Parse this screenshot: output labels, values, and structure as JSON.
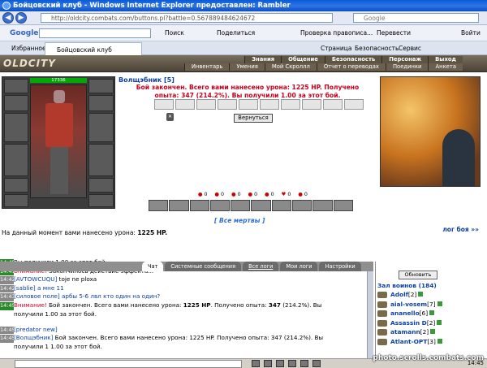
{
  "window": {
    "title": "Бойцовский клуб - Windows Internet Explorer предоставлен: Rambler"
  },
  "address": {
    "url": "http://oldcity.combats.com/buttons.pl?battle=0.567889484624672",
    "search_placeholder": "Google"
  },
  "google_toolbar": {
    "label": "Google",
    "items": [
      "Поиск",
      "Поделиться",
      "Проверка правописа...",
      "Перевести",
      "Войти"
    ]
  },
  "tabs": {
    "favorites": "Избранное",
    "active_tab": "Бойцовский клуб",
    "tools": [
      "Страница",
      "Безопасность",
      "Сервис"
    ]
  },
  "game": {
    "logo": "OLDCITY",
    "menu_top": [
      "Знания",
      "Общение",
      "Безопасность",
      "Персонаж",
      "Выход"
    ],
    "menu_bottom": [
      "Инвентарь",
      "Умения",
      "Мой Скроллл",
      "Отчет о переводах",
      "Поединки",
      "Анкета"
    ]
  },
  "battle": {
    "hp": "17336",
    "opponent_name": "Волщэбник",
    "opponent_level": "[5]",
    "message": "Бой закончен. Всего вами нанесено урона: 1225 HP. Получено опыта: 347 (214.2%). Вы получили",
    "message_amount": "1.00 за этот бой.",
    "back_button": "Вернуться",
    "stats": [
      "0",
      "0",
      "0",
      "0",
      "0",
      "0",
      "0"
    ],
    "all_dead_link": "[ Все мертвы ]",
    "damage_text": "На данный момент вами нанесено урона:",
    "damage_value": "1225 HP.",
    "battle_log_link": "лог боя »»"
  },
  "chat": {
    "tabs": [
      "Чат",
      "Системные сообщения",
      "Все логи",
      "Мои логи",
      "Настройки"
    ],
    "lines": [
      {
        "time": "14:45",
        "style": "g",
        "parts": [
          {
            "c": "",
            "t": "Вы получили 1.00 за этот бой."
          }
        ]
      },
      {
        "time": "14:41",
        "style": "g",
        "parts": [
          {
            "c": "red",
            "t": "Внимание!"
          },
          {
            "c": "",
            "t": " Закончилось действие эффекта..."
          }
        ]
      },
      {
        "time": "14:42",
        "style": "gr",
        "parts": [
          {
            "c": "blue",
            "t": "[AVTOWCUQU]"
          },
          {
            "c": "",
            "t": " toje ne ploxa"
          }
        ]
      },
      {
        "time": "14:42",
        "style": "gr",
        "parts": [
          {
            "c": "blue",
            "t": "[sablie]"
          },
          {
            "c": "blue",
            "t": " а мне 11"
          }
        ]
      },
      {
        "time": "14:43",
        "style": "gr",
        "parts": [
          {
            "c": "blue",
            "t": "[силовое поле]"
          },
          {
            "c": "blue",
            "t": " арбы 5-6 лвл кто один на один?"
          }
        ]
      },
      {
        "time": "14:45",
        "style": "g",
        "parts": [
          {
            "c": "red",
            "t": "Внимание!"
          },
          {
            "c": "",
            "t": " Бой закончен. Всего вами нанесено урона: "
          },
          {
            "c": "b",
            "t": "1225 HP"
          },
          {
            "c": "",
            "t": ". Получено опыта: "
          },
          {
            "c": "b",
            "t": "347"
          },
          {
            "c": "",
            "t": " (214.2%). Вы"
          }
        ]
      },
      {
        "time": "",
        "style": "",
        "parts": [
          {
            "c": "",
            "t": "получили 1.00 за этот бой."
          }
        ]
      },
      {
        "time": "",
        "style": "",
        "parts": [
          {
            "c": "",
            "t": ""
          }
        ]
      },
      {
        "time": "14:45",
        "style": "gr",
        "parts": [
          {
            "c": "blue",
            "t": "[predator new]"
          }
        ]
      },
      {
        "time": "14:45",
        "style": "gr",
        "parts": [
          {
            "c": "blue",
            "t": "[Волщэбник]"
          },
          {
            "c": "",
            "t": " Бой закончен. Всего вами нанесено урона: 1225 HP. Получено опыта: 347 (214.2%). Вы"
          }
        ]
      },
      {
        "time": "",
        "style": "",
        "parts": [
          {
            "c": "",
            "t": "получили 1 1.00 за этот бой."
          }
        ]
      }
    ]
  },
  "online": {
    "refresh": "Обновить",
    "room_title": "Зал воинов (184)",
    "users": [
      {
        "name": "Adolf",
        "level": "[2]"
      },
      {
        "name": "aial-vosem",
        "level": "[7]"
      },
      {
        "name": "ananello",
        "level": "[6]"
      },
      {
        "name": "Assassin D",
        "level": "[2]"
      },
      {
        "name": "atamann",
        "level": "[2]"
      },
      {
        "name": "Atlant-OPT",
        "level": "[3]"
      }
    ]
  },
  "statusbar": {
    "clock": "14:45"
  },
  "watermark": "photo.scrolls.combats.com"
}
